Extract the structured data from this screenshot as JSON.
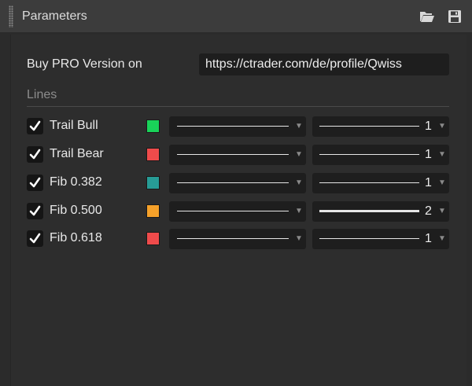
{
  "window": {
    "title": "Parameters",
    "icons": {
      "open": "folder-open-icon",
      "save": "floppy-save-icon"
    }
  },
  "buy": {
    "label": "Buy PRO Version on",
    "url": "https://ctrader.com/de/profile/Qwiss"
  },
  "section": {
    "label": "Lines"
  },
  "lines": [
    {
      "label": "Trail Bull",
      "checked": true,
      "color": "#19d359",
      "width": "1",
      "thick": false
    },
    {
      "label": "Trail Bear",
      "checked": true,
      "color": "#ef4b4b",
      "width": "1",
      "thick": false
    },
    {
      "label": "Fib 0.382",
      "checked": true,
      "color": "#279c96",
      "width": "1",
      "thick": false
    },
    {
      "label": "Fib 0.500",
      "checked": true,
      "color": "#f5a12a",
      "width": "2",
      "thick": true
    },
    {
      "label": "Fib 0.618",
      "checked": true,
      "color": "#ef4b4b",
      "width": "1",
      "thick": false
    }
  ],
  "glyphs": {
    "dropdown_arrow": "▼"
  }
}
